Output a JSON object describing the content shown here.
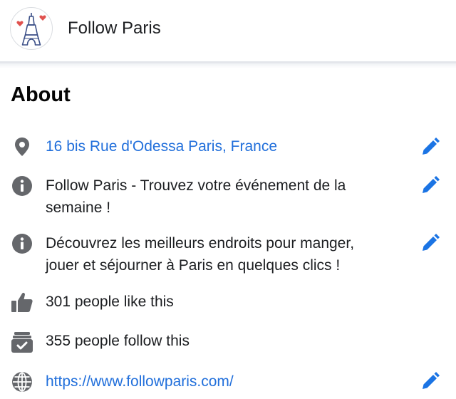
{
  "header": {
    "page_name": "Follow Paris",
    "avatar_icon": "eiffel-tower-hearts-logo"
  },
  "about": {
    "title": "About",
    "rows": [
      {
        "icon": "location-pin-icon",
        "text": "16 bis Rue d'Odessa Paris, France",
        "is_link": true,
        "editable": true
      },
      {
        "icon": "info-icon",
        "text": "Follow Paris - Trouvez votre événement de la semaine !",
        "is_link": false,
        "editable": true
      },
      {
        "icon": "info-icon",
        "text": "Découvrez les meilleurs endroits pour manger, jouer et séjourner à Paris en quelques clics !",
        "is_link": false,
        "editable": true
      },
      {
        "icon": "thumbs-up-icon",
        "text": "301 people like this",
        "is_link": false,
        "editable": false
      },
      {
        "icon": "follow-box-icon",
        "text": "355 people follow this",
        "is_link": false,
        "editable": false
      },
      {
        "icon": "globe-icon",
        "text": "https://www.followparis.com/",
        "is_link": true,
        "editable": true
      }
    ]
  },
  "colors": {
    "link": "#216fdb",
    "icon_gray": "#65676b",
    "edit_blue": "#1b74e4"
  }
}
